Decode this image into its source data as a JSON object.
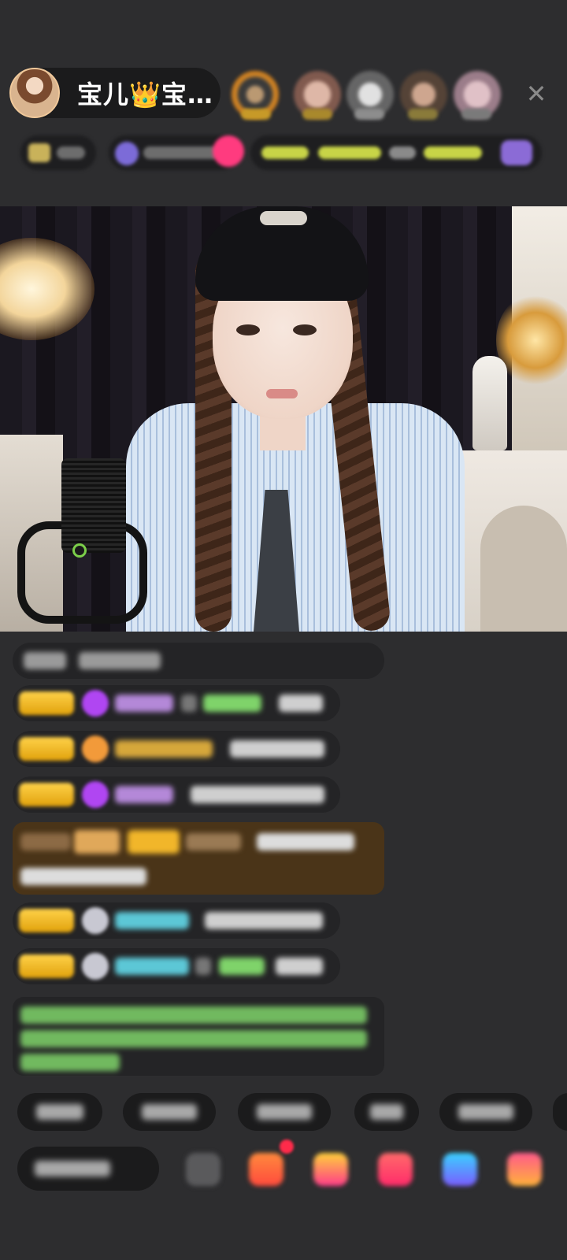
{
  "header": {
    "host_name": "宝儿👑宝…",
    "close_label": "✕"
  },
  "colors": {
    "background": "#2d2d2f",
    "level_badge": "#f0b51f",
    "gift_banner": "#4a3418",
    "green_text": "#7fd36a",
    "cyan_text": "#5cc7d6",
    "pink_icon": "#ff3b7f"
  },
  "icons": {
    "close": "close-icon",
    "avatar": "avatar",
    "gift": "gift-icon",
    "emoji": "emoji-icon"
  }
}
